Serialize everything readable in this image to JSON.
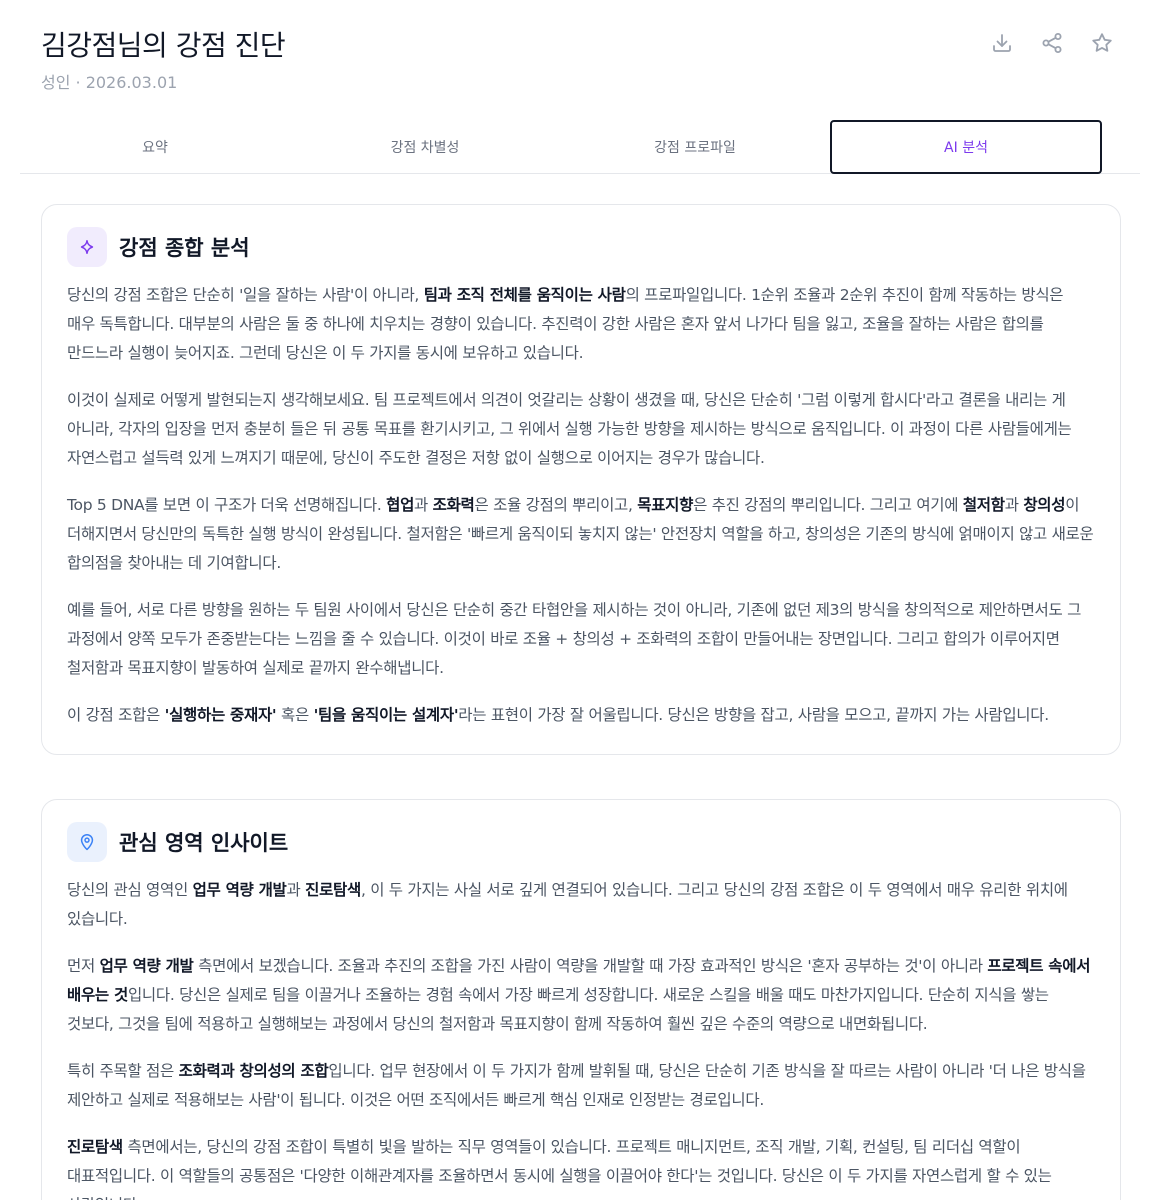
{
  "header": {
    "title": "김강점님의 강점 진단",
    "subtitle": "성인 · 2026.03.01",
    "icons": [
      "download-icon",
      "share-icon",
      "star-icon"
    ]
  },
  "tabs": [
    {
      "label": "요약",
      "active": false
    },
    {
      "label": "강점 차별성",
      "active": false
    },
    {
      "label": "강점 프로파일",
      "active": false
    },
    {
      "label": "AI 분석",
      "active": true
    }
  ],
  "colors": {
    "accent": "#7c3aed",
    "insight_blue": "#3b82f6"
  },
  "sections": [
    {
      "title": "강점 종합 분석",
      "icon": "sparkle-icon",
      "paragraphs": [
        [
          {
            "t": "당신의 강점 조합은 단순히 '일을 잘하는 사람'이 아니라, "
          },
          {
            "t": "팀과 조직 전체를 움직이는 사람",
            "b": true
          },
          {
            "t": "의 프로파일입니다. 1순위 조율과 2순위 추진이 함께 작동하는 방식은 매우 독특합니다. 대부분의 사람은 둘 중 하나에 치우치는 경향이 있습니다. 추진력이 강한 사람은 혼자 앞서 나가다 팀을 잃고, 조율을 잘하는 사람은 합의를 만드느라 실행이 늦어지죠. 그런데 당신은 이 두 가지를 동시에 보유하고 있습니다."
          }
        ],
        [
          {
            "t": "이것이 실제로 어떻게 발현되는지 생각해보세요. 팀 프로젝트에서 의견이 엇갈리는 상황이 생겼을 때, 당신은 단순히 '그럼 이렇게 합시다'라고 결론을 내리는 게 아니라, 각자의 입장을 먼저 충분히 들은 뒤 공통 목표를 환기시키고, 그 위에서 실행 가능한 방향을 제시하는 방식으로 움직입니다. 이 과정이 다른 사람들에게는 자연스럽고 설득력 있게 느껴지기 때문에, 당신이 주도한 결정은 저항 없이 실행으로 이어지는 경우가 많습니다."
          }
        ],
        [
          {
            "t": "Top 5 DNA를 보면 이 구조가 더욱 선명해집니다. "
          },
          {
            "t": "협업",
            "b": true
          },
          {
            "t": "과 "
          },
          {
            "t": "조화력",
            "b": true
          },
          {
            "t": "은 조율 강점의 뿌리이고, "
          },
          {
            "t": "목표지향",
            "b": true
          },
          {
            "t": "은 추진 강점의 뿌리입니다. 그리고 여기에 "
          },
          {
            "t": "철저함",
            "b": true
          },
          {
            "t": "과 "
          },
          {
            "t": "창의성",
            "b": true
          },
          {
            "t": "이 더해지면서 당신만의 독특한 실행 방식이 완성됩니다. 철저함은 '빠르게 움직이되 놓치지 않는' 안전장치 역할을 하고, 창의성은 기존의 방식에 얽매이지 않고 새로운 합의점을 찾아내는 데 기여합니다."
          }
        ],
        [
          {
            "t": "예를 들어, 서로 다른 방향을 원하는 두 팀원 사이에서 당신은 단순히 중간 타협안을 제시하는 것이 아니라, 기존에 없던 제3의 방식을 창의적으로 제안하면서도 그 과정에서 양쪽 모두가 존중받는다는 느낌을 줄 수 있습니다. 이것이 바로 조율 + 창의성 + 조화력의 조합이 만들어내는 장면입니다. 그리고 합의가 이루어지면 철저함과 목표지향이 발동하여 실제로 끝까지 완수해냅니다."
          }
        ],
        [
          {
            "t": "이 강점 조합은 "
          },
          {
            "t": "'실행하는 중재자'",
            "b": true
          },
          {
            "t": " 혹은 "
          },
          {
            "t": "'팀을 움직이는 설계자'",
            "b": true
          },
          {
            "t": "라는 표현이 가장 잘 어울립니다. 당신은 방향을 잡고, 사람을 모으고, 끝까지 가는 사람입니다."
          }
        ]
      ]
    },
    {
      "title": "관심 영역 인사이트",
      "icon": "location-pin-icon",
      "paragraphs": [
        [
          {
            "t": "당신의 관심 영역인 "
          },
          {
            "t": "업무 역량 개발",
            "b": true
          },
          {
            "t": "과 "
          },
          {
            "t": "진로탐색",
            "b": true
          },
          {
            "t": ", 이 두 가지는 사실 서로 깊게 연결되어 있습니다. 그리고 당신의 강점 조합은 이 두 영역에서 매우 유리한 위치에 있습니다."
          }
        ],
        [
          {
            "t": "먼저 "
          },
          {
            "t": "업무 역량 개발",
            "b": true
          },
          {
            "t": " 측면에서 보겠습니다. 조율과 추진의 조합을 가진 사람이 역량을 개발할 때 가장 효과적인 방식은 '혼자 공부하는 것'이 아니라 "
          },
          {
            "t": "프로젝트 속에서 배우는 것",
            "b": true
          },
          {
            "t": "입니다. 당신은 실제로 팀을 이끌거나 조율하는 경험 속에서 가장 빠르게 성장합니다. 새로운 스킬을 배울 때도 마찬가지입니다. 단순히 지식을 쌓는 것보다, 그것을 팀에 적용하고 실행해보는 과정에서 당신의 철저함과 목표지향이 함께 작동하여 훨씬 깊은 수준의 역량으로 내면화됩니다."
          }
        ],
        [
          {
            "t": "특히 주목할 점은 "
          },
          {
            "t": "조화력과 창의성의 조합",
            "b": true
          },
          {
            "t": "입니다. 업무 현장에서 이 두 가지가 함께 발휘될 때, 당신은 단순히 기존 방식을 잘 따르는 사람이 아니라 '더 나은 방식을 제안하고 실제로 적용해보는 사람'이 됩니다. 이것은 어떤 조직에서든 빠르게 핵심 인재로 인정받는 경로입니다."
          }
        ],
        [
          {
            "t": "진로탐색",
            "b": true
          },
          {
            "t": " 측면에서는, 당신의 강점 조합이 특별히 빛을 발하는 직무 영역들이 있습니다. 프로젝트 매니지먼트, 조직 개발, 기획, 컨설팅, 팀 리더십 역할이 대표적입니다. 이 역할들의 공통점은 '다양한 이해관계자를 조율하면서 동시에 실행을 이끌어야 한다'는 것입니다. 당신은 이 두 가지를 자연스럽게 할 수 있는 사람입니다."
          }
        ]
      ]
    }
  ]
}
